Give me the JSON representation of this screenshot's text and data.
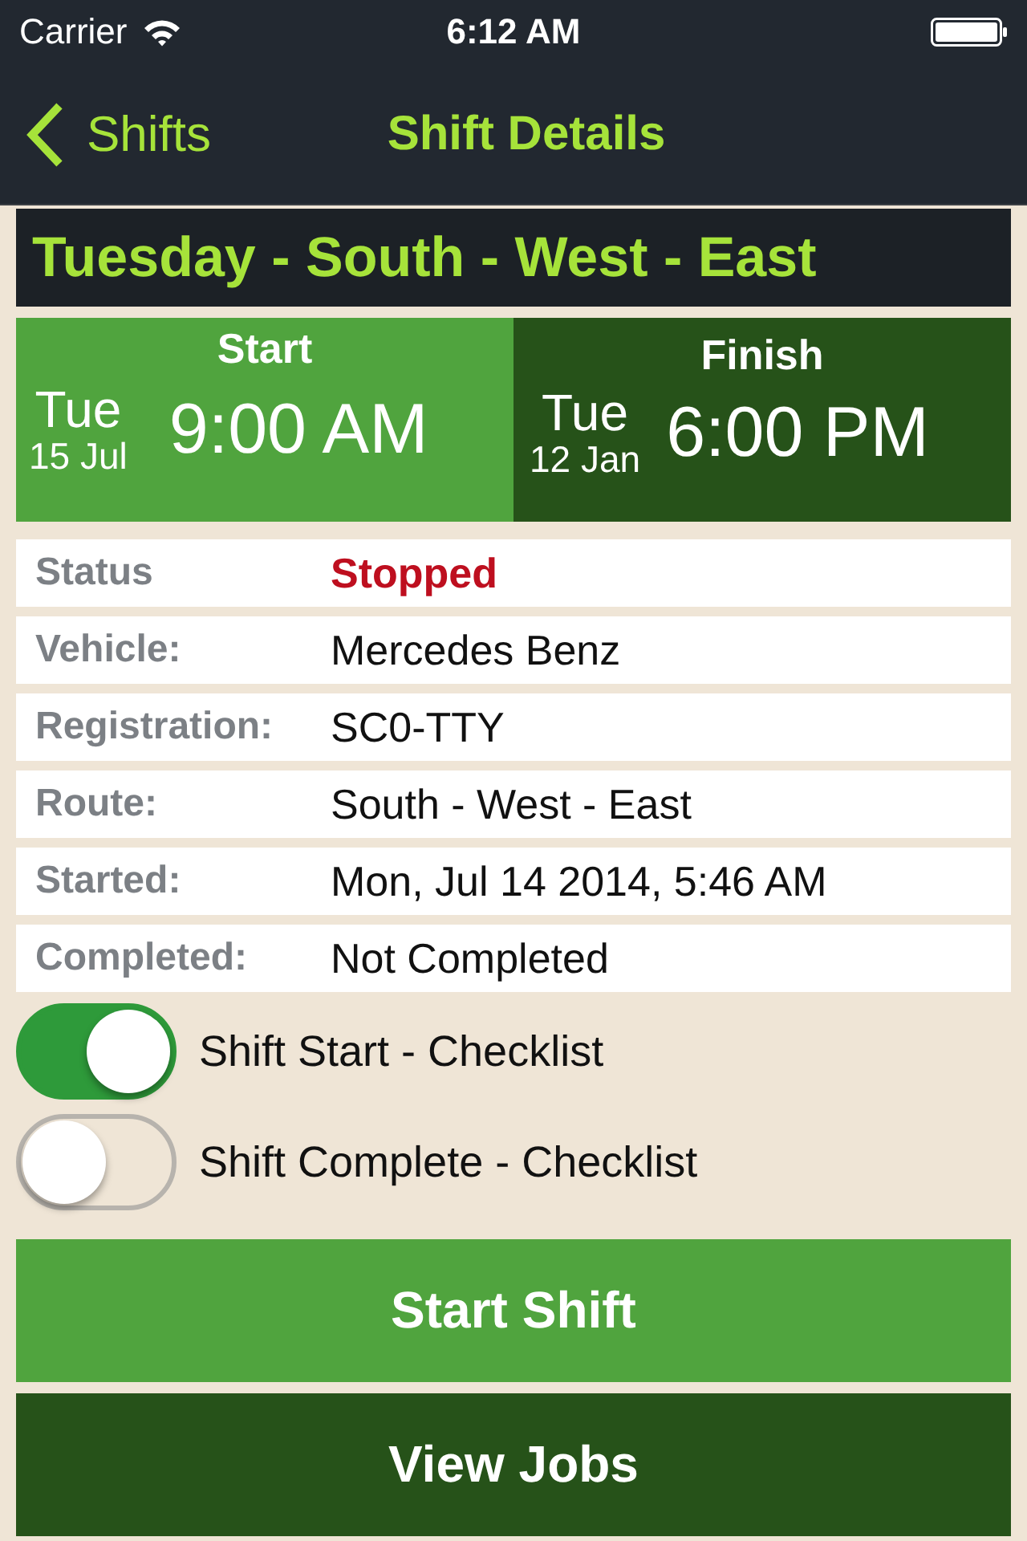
{
  "status_bar": {
    "carrier": "Carrier",
    "time": "6:12 AM"
  },
  "nav_bar": {
    "back_label": "Shifts",
    "title": "Shift Details"
  },
  "shift_title": "Tuesday - South - West - East",
  "schedule": [
    {
      "kind": "start",
      "heading": "Start",
      "weekday": "Tue",
      "date": "15 Jul",
      "time": "9:00 AM"
    },
    {
      "kind": "finish",
      "heading": "Finish",
      "weekday": "Tue",
      "date": "12 Jan",
      "time": "6:00 PM"
    }
  ],
  "details": [
    {
      "kind": "status",
      "label": "Status",
      "value": "Stopped"
    },
    {
      "kind": "text",
      "label": "Vehicle:",
      "value": "Mercedes Benz"
    },
    {
      "kind": "text",
      "label": "Registration:",
      "value": "SC0-TTY"
    },
    {
      "kind": "text",
      "label": "Route:",
      "value": "South - West - East"
    },
    {
      "kind": "text",
      "label": "Started:",
      "value": "Mon, Jul 14 2014, 5:46 AM"
    },
    {
      "kind": "text",
      "label": "Completed:",
      "value": "Not Completed"
    }
  ],
  "checklists": [
    {
      "label": "Shift Start - Checklist",
      "on": true
    },
    {
      "label": "Shift Complete - Checklist",
      "on": false
    }
  ],
  "buttons": [
    {
      "kind": "primary",
      "label": "Start Shift"
    },
    {
      "kind": "secondary",
      "label": "View Jobs"
    }
  ]
}
